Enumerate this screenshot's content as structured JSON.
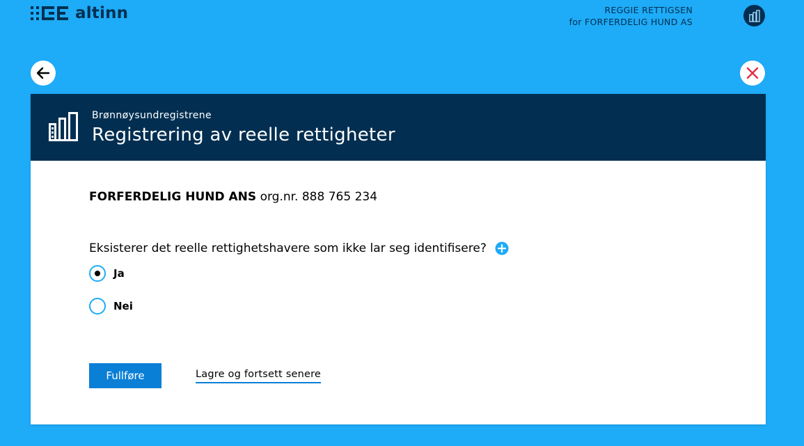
{
  "header": {
    "logo_text": "altinn",
    "user_name": "REGGIE RETTIGSEN",
    "user_org": "for FORFERDELIG HUND AS"
  },
  "card": {
    "agency": "Brønnøysundregistrene",
    "title": "Registrering av reelle rettigheter",
    "org_name": "FORFERDELIG HUND ANS",
    "org_number": "org.nr. 888 765 234",
    "question": "Eksisterer det reelle rettighetshavere som ikke lar seg identifisere?",
    "options": [
      {
        "label": "Ja",
        "selected": true
      },
      {
        "label": "Nei",
        "selected": false
      }
    ],
    "submit_label": "Fullføre",
    "save_later_label": "Lagre og fortsett senere"
  },
  "colors": {
    "background": "#1eabf7",
    "navy": "#022f51",
    "primary_button": "#0a7fd6",
    "close_red": "#e02e49"
  },
  "icons": {
    "back": "arrow-left-icon",
    "close": "close-icon",
    "help": "plus-circle-icon",
    "agency": "building-icon",
    "avatar": "building-icon"
  }
}
